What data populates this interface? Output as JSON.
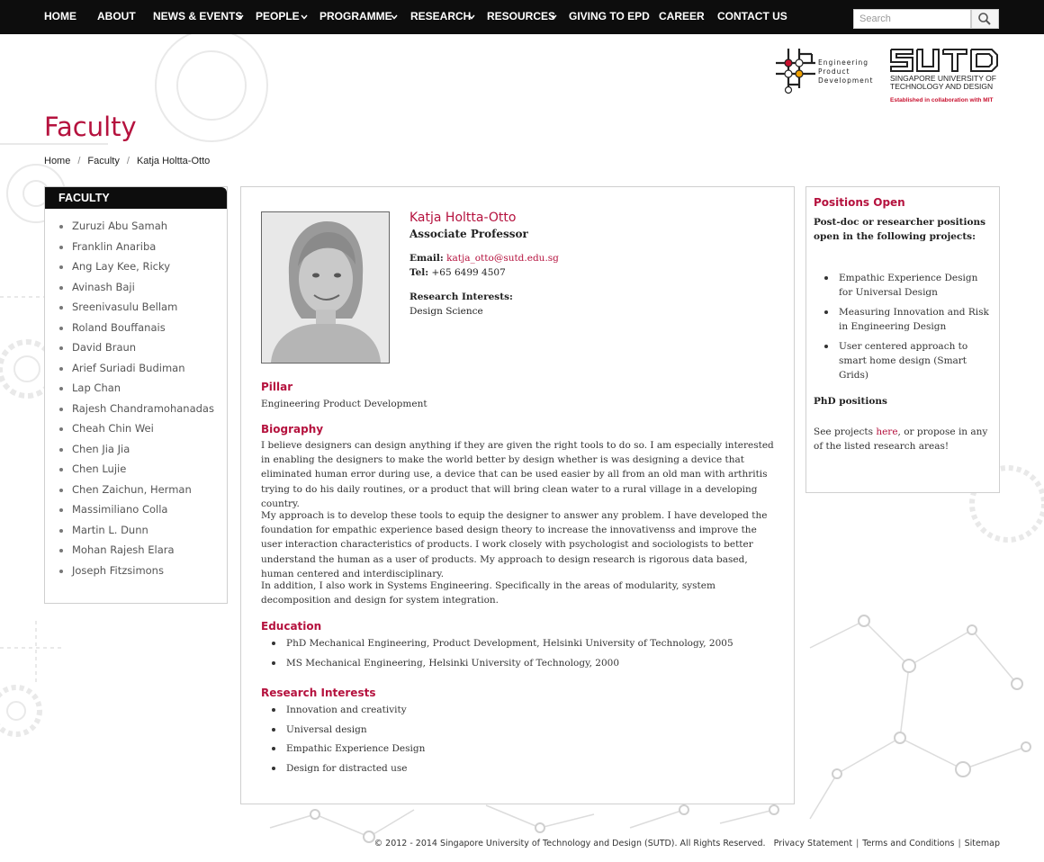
{
  "nav": {
    "items": [
      {
        "label": "HOME",
        "dropdown": false
      },
      {
        "label": "ABOUT",
        "dropdown": false
      },
      {
        "label": "NEWS & EVENTS",
        "dropdown": true
      },
      {
        "label": "PEOPLE",
        "dropdown": true
      },
      {
        "label": "PROGRAMME",
        "dropdown": true
      },
      {
        "label": "RESEARCH",
        "dropdown": true
      },
      {
        "label": "RESOURCES",
        "dropdown": true
      },
      {
        "label": "GIVING TO EPD",
        "dropdown": false
      },
      {
        "label": "CAREER",
        "dropdown": false
      },
      {
        "label": "CONTACT US",
        "dropdown": false
      }
    ],
    "search_placeholder": "Search"
  },
  "logos": {
    "epd_lines": [
      "Engineering",
      "Product",
      "Development"
    ],
    "sutd_name_line1": "SINGAPORE UNIVERSITY OF",
    "sutd_name_line2": "TECHNOLOGY AND DESIGN",
    "sutd_tagline": "Established in collaboration with MIT"
  },
  "page": {
    "title": "Faculty",
    "breadcrumb": [
      "Home",
      "Faculty",
      "Katja Holtta-Otto"
    ]
  },
  "sidebar": {
    "heading": "FACULTY",
    "items": [
      "Zuruzi Abu Samah",
      "Franklin Anariba",
      "Ang Lay Kee, Ricky",
      "Avinash Baji",
      "Sreenivasulu Bellam",
      "Roland Bouffanais",
      "David Braun",
      "Arief Suriadi Budiman",
      "Lap Chan",
      "Rajesh Chandramohanadas",
      "Cheah Chin Wei",
      "Chen Jia Jia",
      "Chen Lujie",
      "Chen Zaichun, Herman",
      "Massimiliano Colla",
      "Martin L. Dunn",
      "Mohan Rajesh Elara",
      "Joseph Fitzsimons"
    ]
  },
  "profile": {
    "name": "Katja Holtta-Otto",
    "title": "Associate Professor",
    "email_label": "Email:",
    "email": "katja_otto@sutd.edu.sg",
    "tel_label": "Tel:",
    "tel": "+65 6499 4507",
    "interests_label": "Research Interests:",
    "interests": "Design Science",
    "pillar_heading": "Pillar",
    "pillar": "Engineering Product Development",
    "biography_heading": "Biography",
    "biography": [
      "I believe designers can design anything if they are given the right tools to do so. I am especially interested in enabling the designers to make the world better by design whether is was designing a device that eliminated human error during use, a device that can be used easier by all from an old man with arthritis trying to do his daily routines, or a product that will bring clean water to a rural village in a developing country.",
      "My approach is to develop these tools to equip the designer to answer any problem. I have developed the foundation for empathic experience based design theory to increase the innovativenss and improve the user interaction characteristics of products. I work closely with psychologist and sociologists to better understand the human as a user of products. My approach to design research is rigorous data based, human centered and interdisciplinary.",
      "In addition, I also work in Systems Engineering. Specifically in the areas of modularity, system decomposition and design for system integration."
    ],
    "education_heading": "Education",
    "education": [
      "PhD Mechanical Engineering, Product Development, Helsinki University of Technology, 2005",
      "MS Mechanical Engineering, Helsinki University of Technology, 2000"
    ],
    "research_heading": "Research Interests",
    "research": [
      "Innovation and creativity",
      "Universal design",
      "Empathic Experience Design",
      "Design for distracted use"
    ]
  },
  "positions": {
    "heading": "Positions Open",
    "intro": "Post-doc or researcher positions open in the following projects:",
    "projects": [
      "Empathic Experience Design for Universal Design",
      "Measuring Innovation and Risk in Engineering Design",
      "User centered approach to smart home design (Smart Grids)"
    ],
    "phd_heading": "PhD positions",
    "phd_prefix": "See projects ",
    "phd_link": "here",
    "phd_suffix": ", or propose in any of the listed research areas!"
  },
  "footer": {
    "copyright": "© 2012 - 2014 Singapore University of Technology and Design (SUTD). All Rights Reserved.",
    "links": [
      "Privacy Statement",
      "Terms and Conditions",
      "Sitemap"
    ]
  },
  "colors": {
    "accent": "#b5123e",
    "nav_bg": "#0d0d0d",
    "sutd_red": "#c8102e"
  }
}
